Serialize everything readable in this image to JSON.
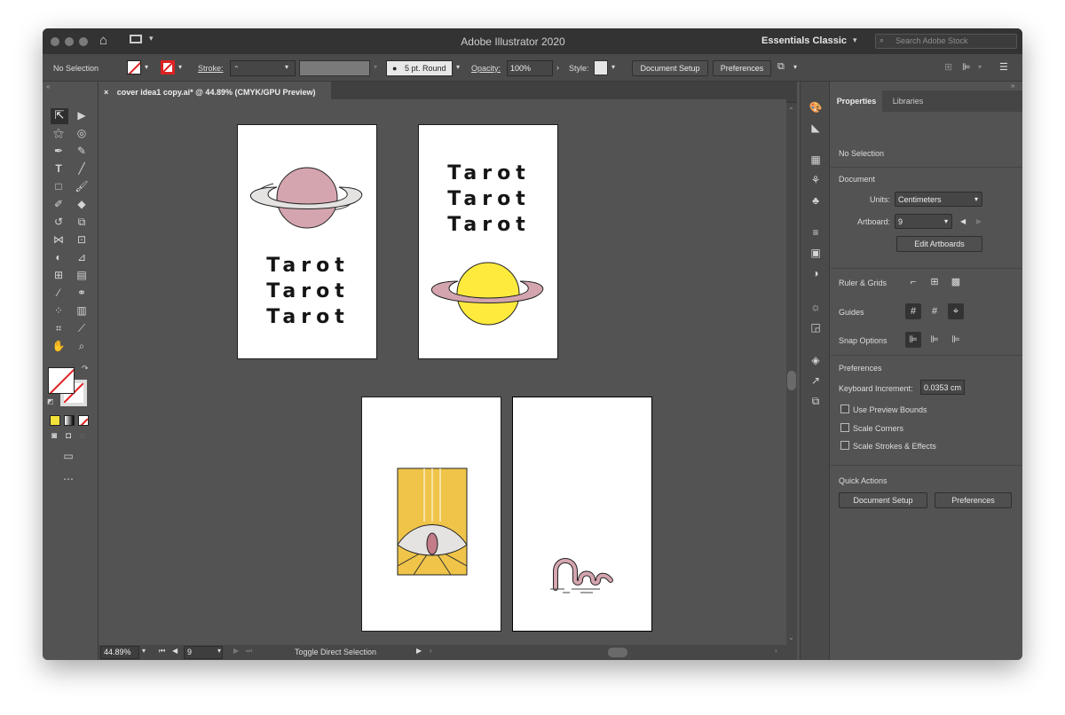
{
  "window": {
    "title": "Adobe Illustrator 2020",
    "workspace": "Essentials Classic",
    "search_placeholder": "Search Adobe Stock"
  },
  "control": {
    "selection": "No Selection",
    "stroke_label": "Stroke:",
    "brush": "5 pt. Round",
    "opacity_label": "Opacity:",
    "opacity_value": "100%",
    "style_label": "Style:",
    "document_setup": "Document Setup",
    "preferences": "Preferences"
  },
  "tab": {
    "label": "cover idea1 copy.ai* @ 44.89% (CMYK/GPU Preview)",
    "close": "×"
  },
  "artboards": {
    "tarot_word": "Tarot"
  },
  "status": {
    "zoom": "44.89%",
    "artboard": "9",
    "tool_hint": "Toggle Direct Selection"
  },
  "panel": {
    "tabs": [
      "Properties",
      "Libraries"
    ],
    "selection": "No Selection",
    "document_heading": "Document",
    "units_label": "Units:",
    "units_value": "Centimeters",
    "artboard_label": "Artboard:",
    "artboard_value": "9",
    "edit_artboards": "Edit Artboards",
    "ruler_grids": "Ruler & Grids",
    "guides": "Guides",
    "snap_options": "Snap Options",
    "preferences_heading": "Preferences",
    "keyboard_increment_label": "Keyboard Increment:",
    "keyboard_increment_value": "0.0353 cm",
    "checkboxes": [
      "Use Preview Bounds",
      "Scale Corners",
      "Scale Strokes & Effects"
    ],
    "quick_actions": "Quick Actions",
    "qa_document_setup": "Document Setup",
    "qa_preferences": "Preferences"
  },
  "colors": {
    "pink": "#d4a5ae",
    "yellow": "#fdea3d",
    "gold": "#efc449",
    "ring": "#e5e3e2"
  },
  "icons": [
    "home-icon",
    "layout-icon",
    "search-icon",
    "selection-tool-icon",
    "direct-selection-icon",
    "pen-icon",
    "type-icon",
    "line-icon",
    "rectangle-icon",
    "paintbrush-icon",
    "hand-icon",
    "zoom-icon"
  ]
}
